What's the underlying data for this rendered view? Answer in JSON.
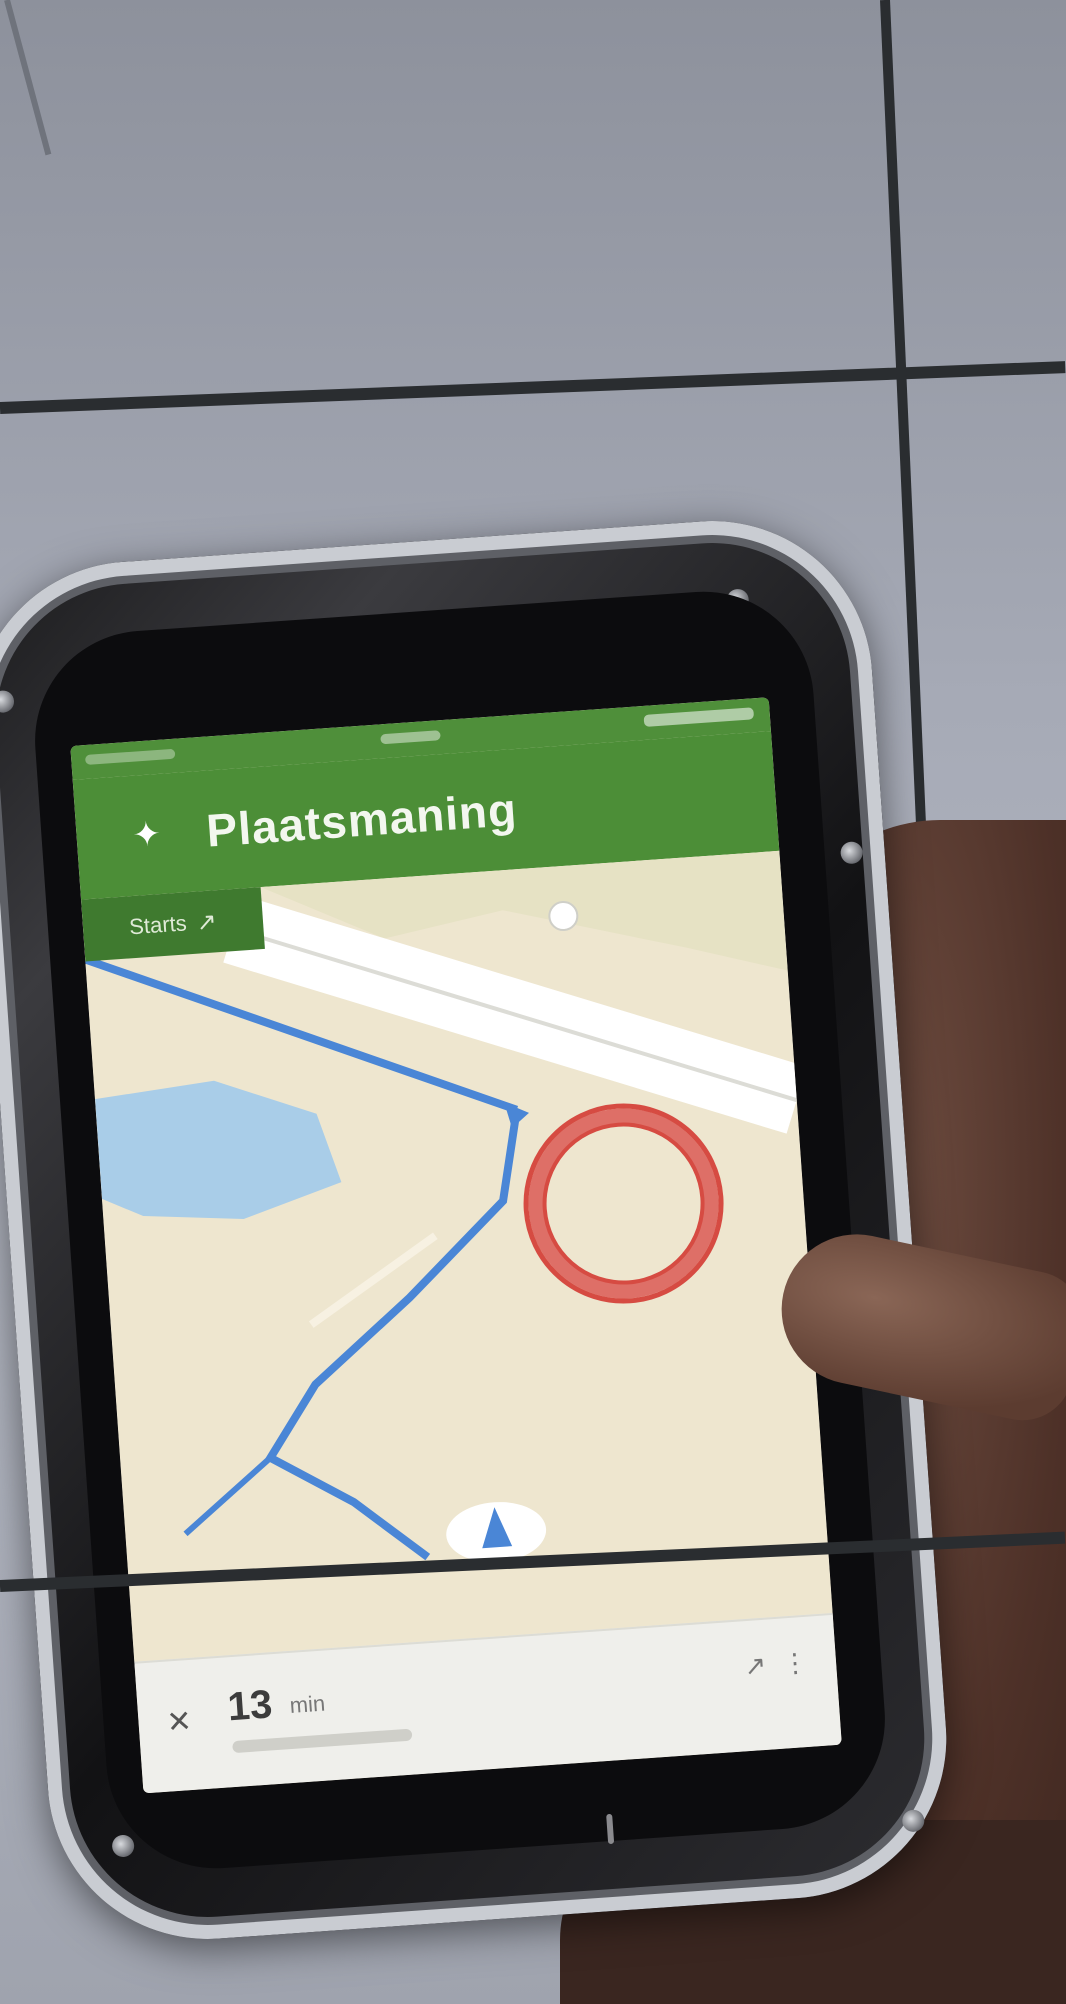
{
  "scene": {
    "description_tag": "photo",
    "background_color": "#9ea3af"
  },
  "app": {
    "header": {
      "menu_icon": "pin-icon",
      "title": "Plaatsmaning"
    },
    "chip": {
      "label": "Starts",
      "icon": "arrow-icon"
    },
    "bottom_panel": {
      "close_icon": "close-icon",
      "eta_value": "13",
      "eta_unit": "min",
      "route_icon": "route-icon",
      "more_icon": "more-icon"
    },
    "colors": {
      "header_green": "#4c8e37",
      "route_blue": "#4a86d6",
      "focus_ring_red": "#d64b42",
      "map_land": "#f1ead8",
      "water": "#a9cde8"
    }
  }
}
